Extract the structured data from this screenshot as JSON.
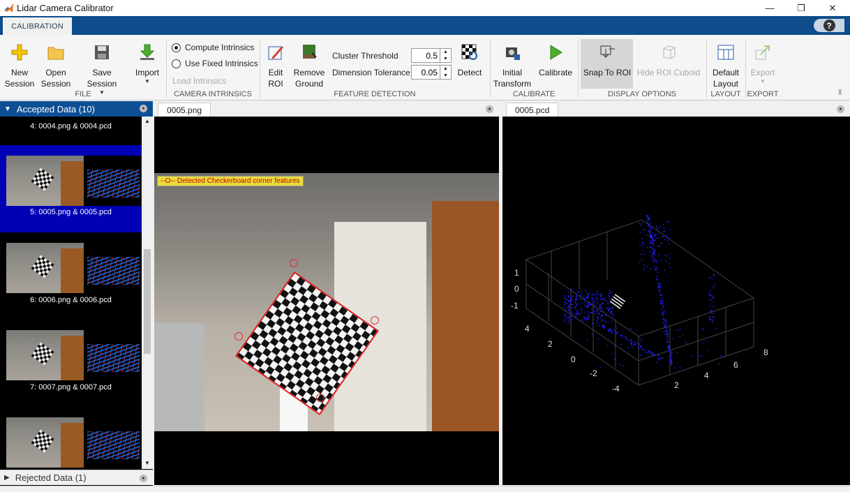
{
  "window": {
    "title": "Lidar Camera Calibrator",
    "minimize": "—",
    "restore": "❐",
    "close": "✕"
  },
  "ribbon": {
    "tab": "CALIBRATION",
    "help": "?",
    "file": {
      "new_session": [
        "New",
        "Session"
      ],
      "open_session": [
        "Open",
        "Session"
      ],
      "save_session": "Save Session",
      "import": "Import",
      "section": "FILE"
    },
    "intrinsics": {
      "compute": "Compute Intrinsics",
      "fixed": "Use Fixed Intrinsics",
      "load": "Load Intrinsics",
      "selected": "compute",
      "section": "CAMERA INTRINSICS"
    },
    "features": {
      "edit_roi": [
        "Edit",
        "ROI"
      ],
      "remove_ground": [
        "Remove",
        "Ground"
      ],
      "cluster_threshold_label": "Cluster Threshold",
      "cluster_threshold_value": "0.5",
      "dimension_tolerance_label": "Dimension Tolerance",
      "dimension_tolerance_value": "0.05",
      "detect": "Detect",
      "section": "FEATURE DETECTION"
    },
    "calibrate": {
      "initial_transform": [
        "Initial",
        "Transform"
      ],
      "calibrate": "Calibrate",
      "section": "CALIBRATE"
    },
    "display": {
      "snap_to_roi": "Snap To ROI",
      "hide_roi_cuboid": "Hide ROI Cuboid",
      "section": "DISPLAY OPTIONS"
    },
    "layout": {
      "default_layout": [
        "Default",
        "Layout"
      ],
      "section": "LAYOUT"
    },
    "export": {
      "export": "Export",
      "section": "EXPORT"
    }
  },
  "data_panel": {
    "accepted_title": "Accepted Data (10)",
    "items": [
      "4: 0004.png & 0004.pcd",
      "5: 0005.png & 0005.pcd",
      "6: 0006.png & 0006.pcd",
      "7: 0007.png & 0007.pcd"
    ],
    "selected_index": 1,
    "rejected_title": "Rejected Data (1)"
  },
  "image_view": {
    "tab": "0005.png",
    "legend": "--O-- Detected Checkerboard corner features"
  },
  "pcd_view": {
    "tab": "0005.pcd",
    "z_ticks": [
      "1",
      "0",
      "-1"
    ],
    "y_ticks": [
      "4",
      "2",
      "0",
      "-2",
      "-4"
    ],
    "x_ticks": [
      "2",
      "4",
      "6",
      "8"
    ],
    "point_color": "#1e1ee6"
  }
}
